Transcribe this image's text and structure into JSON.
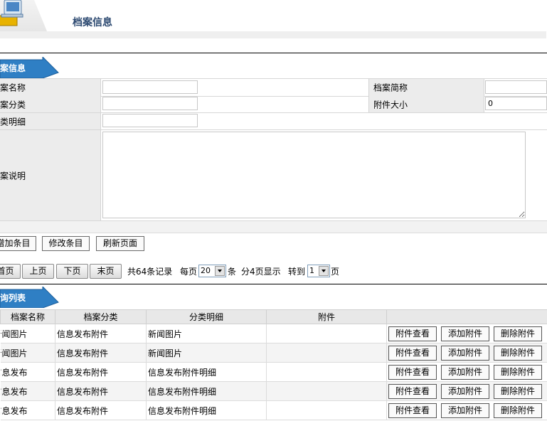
{
  "header": {
    "title": "档案信息",
    "logo_icon": "computer-folder-icon"
  },
  "form_section": {
    "tab_label": "档案信息",
    "fields": {
      "name_label": "档案名称",
      "short_name_label": "档案简称",
      "category_label": "档案分类",
      "attachment_size_label": "附件大小",
      "attachment_size_value": "0",
      "category_detail_label": "分类明细",
      "description_label": "档案说明"
    }
  },
  "actions": {
    "add": "增加条目",
    "modify": "修改条目",
    "refresh": "刷新页面"
  },
  "pager": {
    "first": "首页",
    "prev": "上页",
    "next": "下页",
    "last": "末页",
    "total_text": "共64条记录",
    "per_page_prefix": "每页",
    "per_page_value": "20",
    "per_page_suffix": "条",
    "pages_text": "分4页显示",
    "goto_prefix": "转到",
    "goto_value": "1",
    "goto_suffix": "页"
  },
  "list_section": {
    "tab_label": "查询列表",
    "columns": [
      "档案名称",
      "档案分类",
      "分类明细",
      "附件",
      ""
    ],
    "row_buttons": {
      "view": "附件查看",
      "add": "添加附件",
      "delete": "删除附件"
    },
    "rows": [
      {
        "name": "新闻图片",
        "category": "信息发布附件",
        "detail": "新闻图片",
        "attachment": ""
      },
      {
        "name": "新闻图片",
        "category": "信息发布附件",
        "detail": "新闻图片",
        "attachment": ""
      },
      {
        "name": "信息发布",
        "category": "信息发布附件",
        "detail": "信息发布附件明细",
        "attachment": ""
      },
      {
        "name": "信息发布",
        "category": "信息发布附件",
        "detail": "信息发布附件明细",
        "attachment": ""
      },
      {
        "name": "信息发布",
        "category": "信息发布附件",
        "detail": "信息发布附件明细",
        "attachment": ""
      }
    ]
  }
}
